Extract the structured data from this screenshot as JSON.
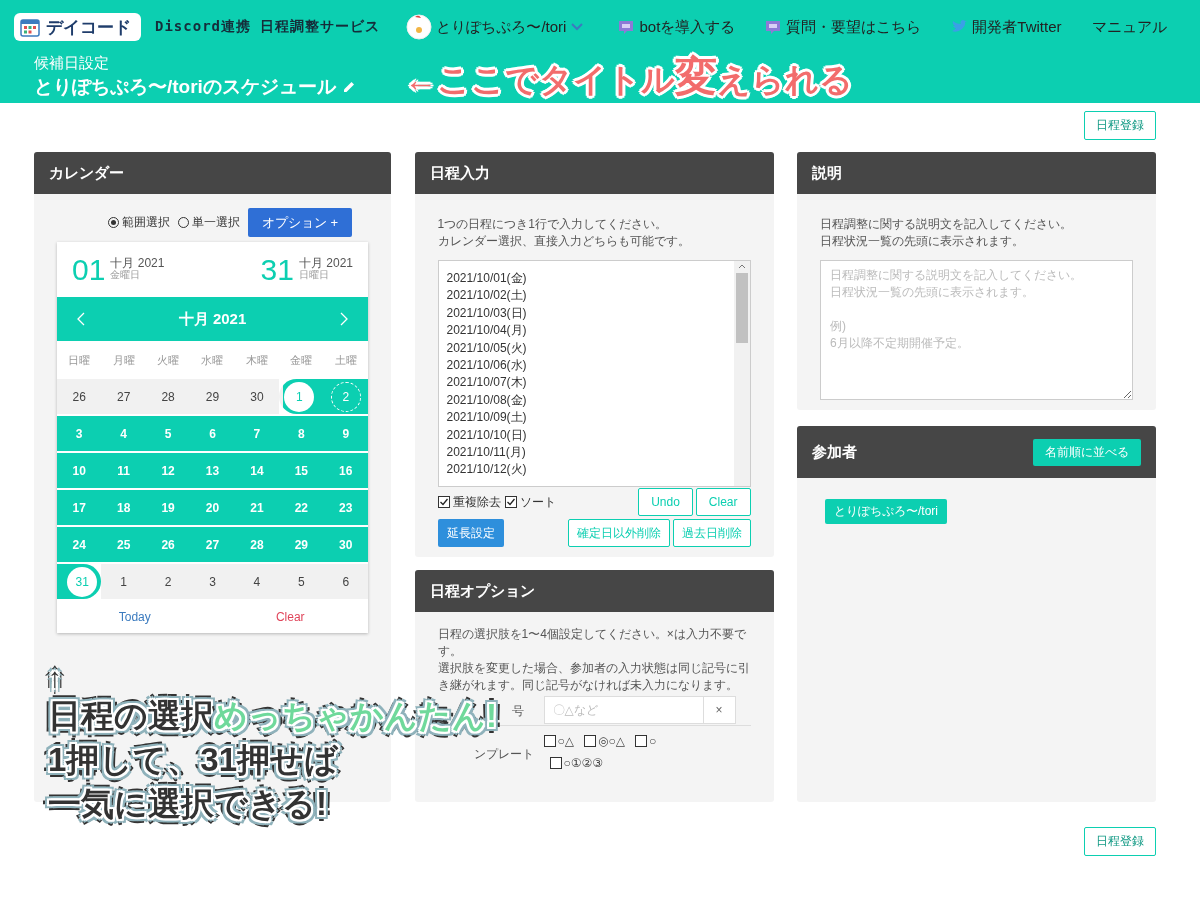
{
  "header": {
    "logo_text": "デイコード",
    "tagline": "Discord連携 日程調整サービス",
    "user": "とりぽちぷろ〜/tori",
    "links": [
      {
        "label": "botを導入する",
        "kind": "chat"
      },
      {
        "label": "質問・要望はこちら",
        "kind": "chat"
      },
      {
        "label": "開発者Twitter",
        "kind": "bird"
      },
      {
        "label": "マニュアル",
        "kind": "plain"
      }
    ],
    "subtitle": "候補日設定",
    "title": "とりぽちぷろ〜/toriのスケジュール"
  },
  "register_button_top": "日程登録",
  "calendar_panel": {
    "title": "カレンダー",
    "modes": [
      {
        "label": "範囲選択",
        "selected": true
      },
      {
        "label": "単一選択",
        "selected": false
      }
    ],
    "options_button": "オプション +",
    "start": {
      "day": "01",
      "month": "十月",
      "year": "2021",
      "weekday": "金曜日"
    },
    "end": {
      "day": "31",
      "month": "十月",
      "year": "2021",
      "weekday": "日曜日"
    },
    "month_label": "十月 2021",
    "weekdays": [
      "日曜",
      "月曜",
      "火曜",
      "水曜",
      "木曜",
      "金曜",
      "土曜"
    ],
    "weeks": [
      [
        {
          "day": "26",
          "kind": "outside"
        },
        {
          "day": "27",
          "kind": "outside"
        },
        {
          "day": "28",
          "kind": "outside"
        },
        {
          "day": "29",
          "kind": "outside"
        },
        {
          "day": "30",
          "kind": "outside"
        },
        {
          "day": "1",
          "kind": "start"
        },
        {
          "day": "2",
          "kind": "hover"
        }
      ],
      [
        {
          "day": "3",
          "kind": "range"
        },
        {
          "day": "4",
          "kind": "range"
        },
        {
          "day": "5",
          "kind": "range"
        },
        {
          "day": "6",
          "kind": "range"
        },
        {
          "day": "7",
          "kind": "range"
        },
        {
          "day": "8",
          "kind": "range"
        },
        {
          "day": "9",
          "kind": "range"
        }
      ],
      [
        {
          "day": "10",
          "kind": "range"
        },
        {
          "day": "11",
          "kind": "range"
        },
        {
          "day": "12",
          "kind": "range"
        },
        {
          "day": "13",
          "kind": "range"
        },
        {
          "day": "14",
          "kind": "range"
        },
        {
          "day": "15",
          "kind": "range"
        },
        {
          "day": "16",
          "kind": "range"
        }
      ],
      [
        {
          "day": "17",
          "kind": "range"
        },
        {
          "day": "18",
          "kind": "range"
        },
        {
          "day": "19",
          "kind": "range"
        },
        {
          "day": "20",
          "kind": "range"
        },
        {
          "day": "21",
          "kind": "range"
        },
        {
          "day": "22",
          "kind": "range"
        },
        {
          "day": "23",
          "kind": "range"
        }
      ],
      [
        {
          "day": "24",
          "kind": "range"
        },
        {
          "day": "25",
          "kind": "range"
        },
        {
          "day": "26",
          "kind": "range"
        },
        {
          "day": "27",
          "kind": "range"
        },
        {
          "day": "28",
          "kind": "range"
        },
        {
          "day": "29",
          "kind": "range"
        },
        {
          "day": "30",
          "kind": "range"
        }
      ],
      [
        {
          "day": "31",
          "kind": "end"
        },
        {
          "day": "1",
          "kind": "outside"
        },
        {
          "day": "2",
          "kind": "outside"
        },
        {
          "day": "3",
          "kind": "outside"
        },
        {
          "day": "4",
          "kind": "outside"
        },
        {
          "day": "5",
          "kind": "outside"
        },
        {
          "day": "6",
          "kind": "outside"
        }
      ]
    ],
    "today_button": "Today",
    "clear_button": "Clear"
  },
  "entry_panel": {
    "title": "日程入力",
    "help": [
      "1つの日程につき1行で入力してください。",
      "カレンダー選択、直接入力どちらも可能です。"
    ],
    "lines": [
      "2021/10/01(金)",
      "2021/10/02(土)",
      "2021/10/03(日)",
      "2021/10/04(月)",
      "2021/10/05(火)",
      "2021/10/06(水)",
      "2021/10/07(木)",
      "2021/10/08(金)",
      "2021/10/09(土)",
      "2021/10/10(日)",
      "2021/10/11(月)",
      "2021/10/12(火)"
    ],
    "checks": [
      {
        "label": "重複除去",
        "checked": true
      },
      {
        "label": "ソート",
        "checked": true
      }
    ],
    "buttons": [
      "Undo",
      "Clear"
    ],
    "extend_button": "延長設定",
    "delete_buttons": [
      "確定日以外削除",
      "過去日削除"
    ]
  },
  "option_panel": {
    "title": "日程オプション",
    "help": [
      "日程の選択肢を1〜4個設定してください。×は入力不要です。",
      "選択肢を変更した場合、参加者の入力状態は同じ記号に引き継がれます。同じ記号がなければ未入力になります。"
    ],
    "symbol_label": "号",
    "symbol_placeholder": "〇△など",
    "clear_symbol": "×",
    "template_label": "ンプレート",
    "templates": [
      {
        "label": "○△",
        "checked": false
      },
      {
        "label": "◎○△",
        "checked": false
      },
      {
        "label": "○",
        "checked": false
      },
      {
        "label": "○①②③",
        "checked": false
      }
    ]
  },
  "desc_panel": {
    "title": "説明",
    "help": [
      "日程調整に関する説明文を記入してください。",
      "日程状況一覧の先頭に表示されます。"
    ],
    "placeholder_paragraphs": [
      [
        "日程調整に関する説明文を記入してください。",
        "日程状況一覧の先頭に表示されます。"
      ],
      [
        "例)",
        "6月以降不定期開催予定。"
      ]
    ]
  },
  "member_panel": {
    "title": "参加者",
    "sort_button": "名前順に並べる",
    "members": [
      "とりぽちぷろ〜/tori"
    ]
  },
  "register_button_bottom": "日程登録",
  "annotations": {
    "title_hint": [
      {
        "text": "←ここでタイトル",
        "large": false
      },
      {
        "text": "変",
        "large": true
      },
      {
        "text": "えられる",
        "large": false
      }
    ],
    "calendar_hint": {
      "arrow": "↑",
      "lines": [
        [
          {
            "text": "日程の選択",
            "accent": false
          },
          {
            "text": "めっちゃかんたん!",
            "accent": true
          }
        ],
        [
          {
            "text": "1押して、31押せば",
            "accent": false
          }
        ],
        [
          {
            "text": "一気に選択できる!",
            "accent": false
          }
        ]
      ]
    }
  }
}
